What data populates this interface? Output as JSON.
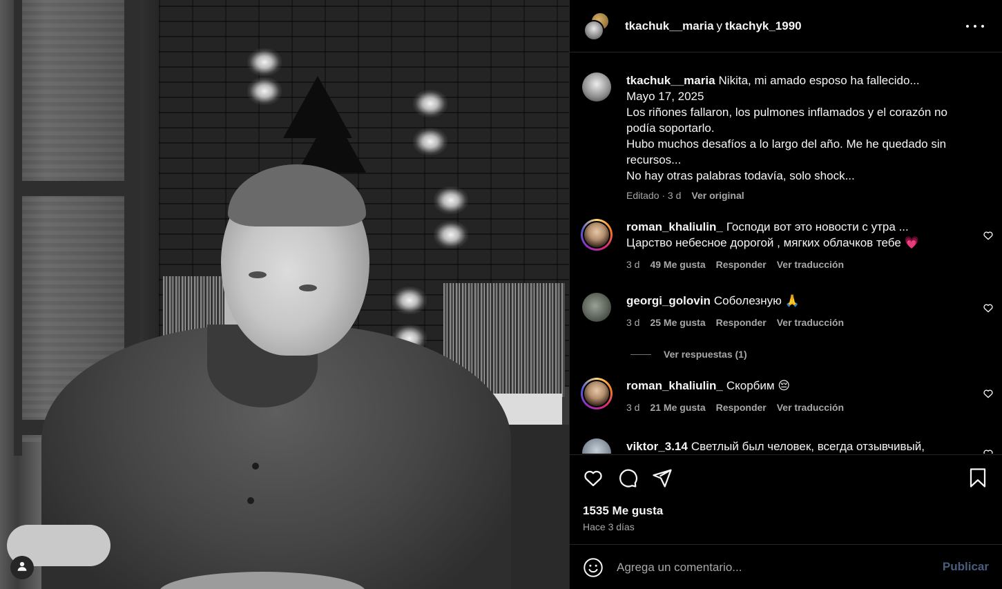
{
  "post": {
    "authors": {
      "primary": "tkachuk__maria",
      "joiner": "y",
      "secondary": "tkachyk_1990"
    }
  },
  "caption": {
    "username": "tkachuk__maria",
    "lines": [
      "Nikita, mi amado esposo ha fallecido...",
      "Mayo 17, 2025",
      "Los riñones fallaron, los pulmones inflamados y el corazón no podía soportarlo.",
      "Hubo muchos desafíos a lo largo del año. Me he quedado sin recursos...",
      "No hay otras palabras todavía, solo shock..."
    ],
    "edited": "Editado · 3 d",
    "see_original": "Ver original"
  },
  "comments": [
    {
      "username": "roman_khaliulin_",
      "text": "Господи вот это новости с утра ...",
      "text2": "Царство небесное дорогой , мягких облачков тебе",
      "emoji": "💗",
      "time": "3 d",
      "likes": "49 Me gusta",
      "reply": "Responder",
      "translate": "Ver traducción"
    },
    {
      "username": "georgi_golovin",
      "text": "Соболезную",
      "emoji": "🙏",
      "time": "3 d",
      "likes": "25 Me gusta",
      "reply": "Responder",
      "translate": "Ver traducción"
    },
    {
      "username": "roman_khaliulin_",
      "text": "Скорбим",
      "emoji": "😔",
      "time": "3 d",
      "likes": "21 Me gusta",
      "reply": "Responder",
      "translate": "Ver traducción"
    },
    {
      "username": "viktor_3.14",
      "text": "Светлый был человек, всегда отзывчивый,"
    }
  ],
  "view_replies": "Ver respuestas (1)",
  "footer": {
    "likes": "1535 Me gusta",
    "time": "Hace 3 días"
  },
  "compose": {
    "placeholder": "Agrega un comentario...",
    "publish": "Publicar"
  },
  "icons": {
    "like": "heart-icon",
    "comment": "comment-icon",
    "share": "share-icon",
    "save": "bookmark-icon",
    "emoji": "emoji-icon",
    "more": "more-icon",
    "user": "user-icon"
  },
  "colors": {
    "background": "#000000",
    "text": "#f5f5f5",
    "muted": "#a8a8a8",
    "divider": "#262626",
    "publish_disabled": "#4a5d7e"
  }
}
